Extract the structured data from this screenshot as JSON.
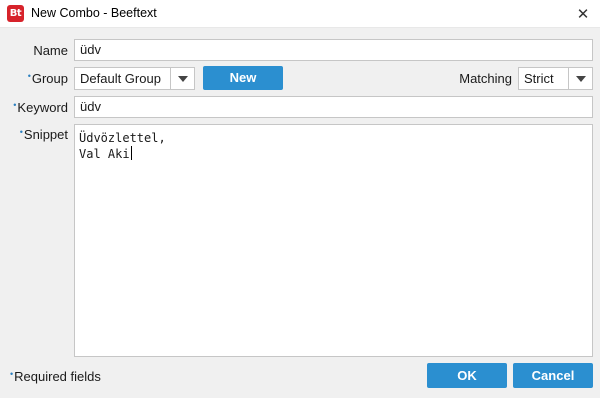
{
  "window": {
    "title": "New Combo - Beeftext",
    "app_icon_text": "Bt",
    "close_glyph": "✕"
  },
  "form": {
    "name": {
      "label": "Name",
      "value": "üdv"
    },
    "group": {
      "label": "Group",
      "required_marker": "•",
      "value": "Default Group",
      "new_button": "New"
    },
    "matching": {
      "label": "Matching",
      "value": "Strict"
    },
    "keyword": {
      "label": "Keyword",
      "required_marker": "•",
      "value": "üdv"
    },
    "snippet": {
      "label": "Snippet",
      "required_marker": "•",
      "lines": [
        "Üdvözlettel,",
        "Val Aki"
      ]
    }
  },
  "footer": {
    "required_marker": "•",
    "required_note": "Required fields",
    "ok_label": "OK",
    "cancel_label": "Cancel"
  },
  "colors": {
    "accent": "#2b8fd0",
    "required_marker": "#2a7fbf",
    "app_icon": "#d7232b"
  }
}
